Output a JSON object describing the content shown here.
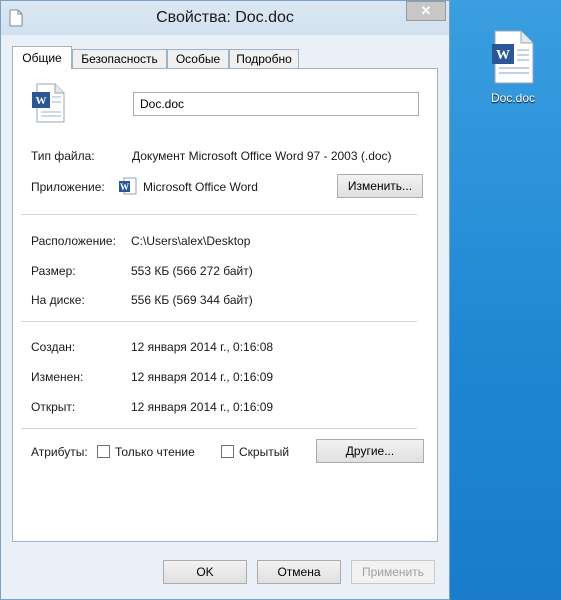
{
  "window": {
    "title": "Свойства: Doc.doc",
    "close_glyph": "✕"
  },
  "tabs": [
    {
      "label": "Общие"
    },
    {
      "label": "Безопасность"
    },
    {
      "label": "Особые"
    },
    {
      "label": "Подробно"
    }
  ],
  "general": {
    "file_name": "Doc.doc",
    "type_label": "Тип файла:",
    "type_value": "Документ Microsoft Office Word 97 - 2003 (.doc)",
    "app_label": "Приложение:",
    "app_value": "Microsoft Office Word",
    "change_button": "Изменить...",
    "location_label": "Расположение:",
    "location_value": "C:\\Users\\alex\\Desktop",
    "size_label": "Размер:",
    "size_value": "553 КБ (566 272 байт)",
    "disk_label": "На диске:",
    "disk_value": "556 КБ (569 344 байт)",
    "created_label": "Создан:",
    "created_value": "12 января 2014 г., 0:16:08",
    "modified_label": "Изменен:",
    "modified_value": "12 января 2014 г., 0:16:09",
    "opened_label": "Открыт:",
    "opened_value": "12 января 2014 г., 0:16:09",
    "attributes_label": "Атрибуты:",
    "readonly_label": "Только чтение",
    "readonly_checked": false,
    "hidden_label": "Скрытый",
    "hidden_checked": false,
    "other_button": "Другие..."
  },
  "footer": {
    "ok": "OK",
    "cancel": "Отмена",
    "apply": "Применить"
  },
  "desktop": {
    "icon_label": "Doc.doc"
  },
  "colors": {
    "word_blue": "#2b5797",
    "desktop": "#1f86d2"
  }
}
